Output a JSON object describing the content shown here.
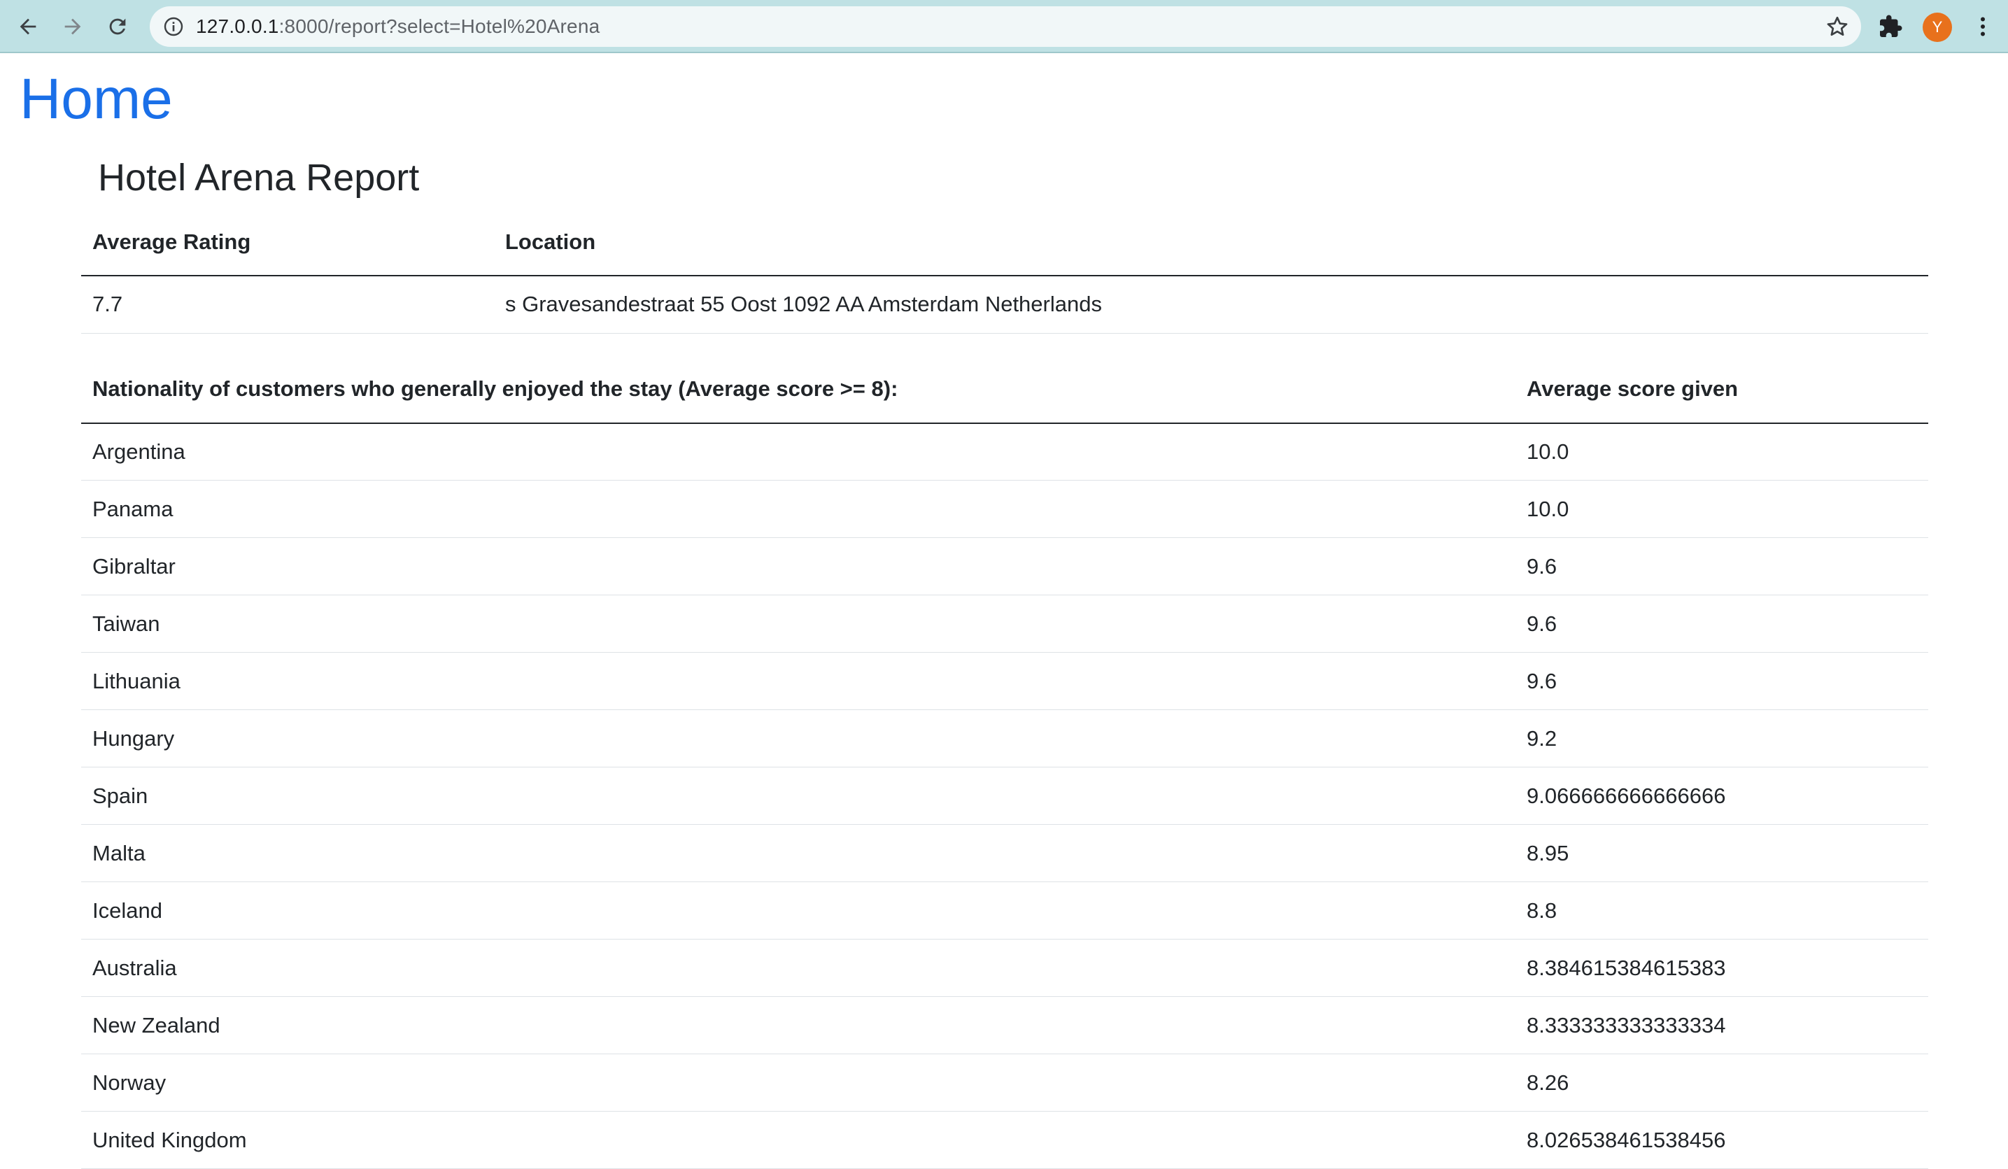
{
  "browser": {
    "url_host": "127.0.0.1",
    "url_rest": ":8000/report?select=Hotel%20Arena",
    "avatar_letter": "Y",
    "icons": [
      "back-icon",
      "forward-icon",
      "reload-icon",
      "info-icon",
      "star-icon",
      "puzzle-icon",
      "kebab-menu-icon"
    ],
    "colors": {
      "toolbar": "#bfe1e4",
      "avatar": "#e8711c"
    }
  },
  "page": {
    "home_link": "Home",
    "title": "Hotel Arena Report",
    "link_color": "#1a6fe8"
  },
  "info_table": {
    "headers": [
      "Average Rating",
      "Location"
    ],
    "row": [
      "7.7",
      "s Gravesandestraat 55 Oost 1092 AA Amsterdam Netherlands"
    ]
  },
  "nationality_table": {
    "headers": [
      "Nationality of customers who generally enjoyed the stay (Average score >= 8):",
      "Average score given"
    ],
    "rows": [
      [
        "Argentina",
        "10.0"
      ],
      [
        "Panama",
        "10.0"
      ],
      [
        "Gibraltar",
        "9.6"
      ],
      [
        "Taiwan",
        "9.6"
      ],
      [
        "Lithuania",
        "9.6"
      ],
      [
        "Hungary",
        "9.2"
      ],
      [
        "Spain",
        "9.066666666666666"
      ],
      [
        "Malta",
        "8.95"
      ],
      [
        "Iceland",
        "8.8"
      ],
      [
        "Australia",
        "8.384615384615383"
      ],
      [
        "New Zealand",
        "8.333333333333334"
      ],
      [
        "Norway",
        "8.26"
      ],
      [
        "United Kingdom",
        "8.026538461538456"
      ]
    ]
  }
}
